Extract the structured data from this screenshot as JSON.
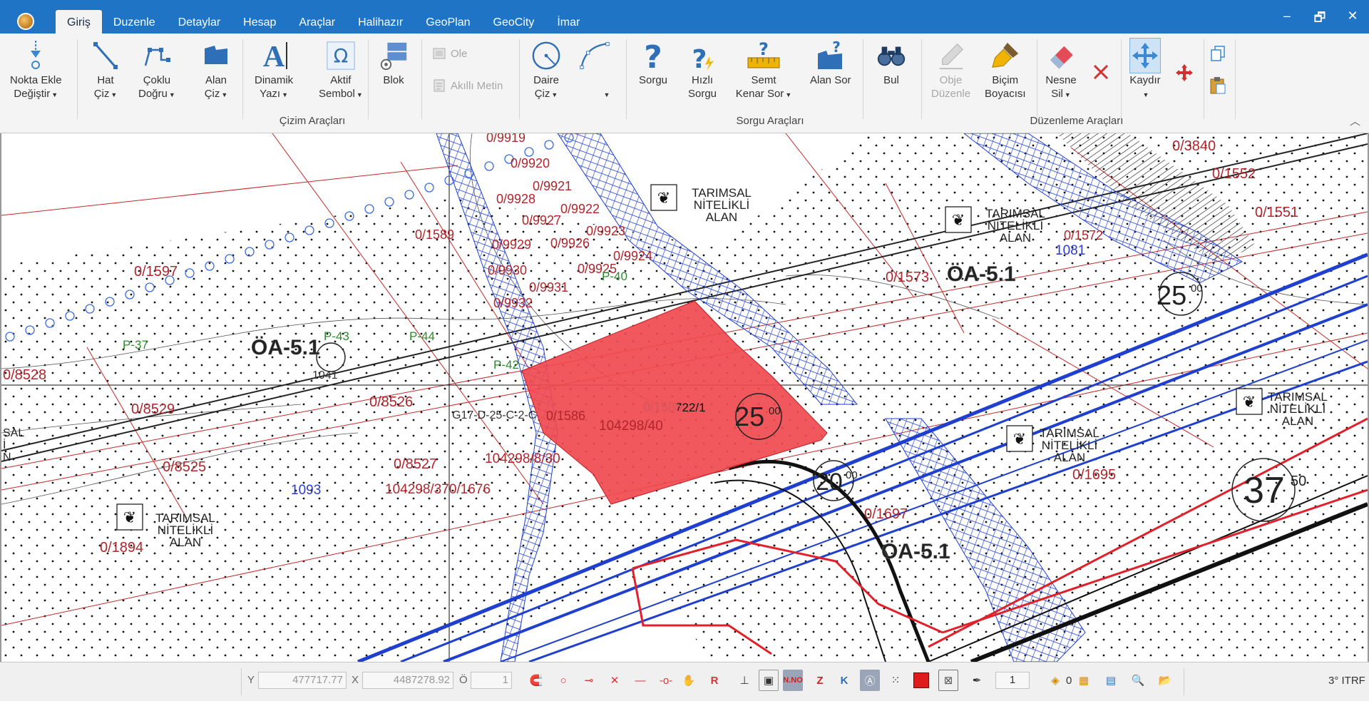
{
  "menu": {
    "tabs": [
      "Giriş",
      "Duzenle",
      "Detaylar",
      "Hesap",
      "Araçlar",
      "Halihazır",
      "GeoPlan",
      "GeoCity",
      "İmar"
    ],
    "active_index": 0
  },
  "window_controls": {
    "minimize": "–",
    "restore": "🗗",
    "close": "✕"
  },
  "ribbon": {
    "buttons": {
      "nokta_ekle": [
        "Nokta Ekle",
        "Değiştir"
      ],
      "hat_ciz": [
        "Hat",
        "Çiz"
      ],
      "coklu_dogru": [
        "Çoklu",
        "Doğru"
      ],
      "alan_ciz": [
        "Alan",
        "Çiz"
      ],
      "dinamik_yazi": [
        "Dinamik",
        "Yazı"
      ],
      "aktif_sembol": [
        "Aktif",
        "Sembol"
      ],
      "blok": "Blok",
      "ole": "Ole",
      "akilli_metin": "Akıllı Metin",
      "daire_ciz": [
        "Daire",
        "Çiz"
      ],
      "sorgu": "Sorgu",
      "hizli_sorgu": [
        "Hızlı",
        "Sorgu"
      ],
      "semt_kenar_sor": [
        "Semt",
        "Kenar Sor"
      ],
      "alan_sor": "Alan Sor",
      "bul": "Bul",
      "obje_duzenle": [
        "Obje",
        "Düzenle"
      ],
      "bicim_boyacisi": [
        "Biçim",
        "Boyacısı"
      ],
      "nesne_sil": [
        "Nesne",
        "Sil"
      ],
      "kaydir": "Kaydır"
    },
    "groups": {
      "cizim": "Çizim Araçları",
      "sorgu": "Sorgu Araçları",
      "duzenleme": "Düzenleme Araçları"
    }
  },
  "map": {
    "selected_parcel": "722/1",
    "highlight_color": "#ef4a4f",
    "labels": {
      "p9919": "0/9919",
      "p9920": "0/9920",
      "p9921": "0/9921",
      "p9928": "0/9928",
      "p9922": "0/9922",
      "p9927": "0/9927",
      "p1589": "0/1589",
      "p9923": "0/9923",
      "p9929": "0/9929",
      "p9926": "0/9926",
      "p9924": "0/9924",
      "p9925": "0/9925",
      "p9930": "0/9930",
      "p9931": "0/9931",
      "p9932": "0/9932",
      "p1597": "0/1597",
      "p8528": "0/8528",
      "p8529": "0/8529",
      "p8526": "0/8526",
      "p8525": "0/8525",
      "p8527": "0/8527",
      "p1586": "0/1586",
      "p1585": "0/1585",
      "p1573": "0/1573",
      "p1572": "0/1572",
      "p1552": "0/1552",
      "p1551": "0/1551",
      "p3840": "0/3840",
      "p1695": "0/1695",
      "p1697": "0/1697",
      "p1894": "0/1894",
      "p10429": "104298/8/30",
      "p10422": "104298/40",
      "p10423": "104298/370/1676",
      "sheet": "G17-D-25-C-2-C",
      "b1093": "1093",
      "b1081": "1081",
      "b1041": "1041",
      "zone1": "ÖA-5.1",
      "zone2": "ÖA-5.1",
      "zone3": "ÖA-5.1",
      "tar1": [
        "TARIMSAL",
        "NİTELİKLİ",
        "ALAN"
      ],
      "tar2": [
        "TARIMSAL",
        "NİTELİKLİ",
        "ALAN"
      ],
      "tar3": [
        "TARIMSAL",
        "NİTELİKLİ",
        "ALAN"
      ],
      "tar4": [
        "TARIMSAL",
        "NİTELİKLİ",
        "ALAN"
      ],
      "tar5": [
        "TARIMSAL",
        "NİTELİKLİ",
        "ALAN"
      ],
      "road1": "25",
      "road1sup": "00",
      "road2": "25",
      "road2sup": "00",
      "road3": "20",
      "road3sup": "00",
      "road4": "37",
      "road4sup": "50",
      "sal": [
        "SAL",
        "İ",
        "N"
      ],
      "p37": "P-37",
      "p43": "P-43",
      "p44": "P-44",
      "p42": "P-42",
      "p40": "P-40"
    }
  },
  "status": {
    "y_label": "Y",
    "y_value": "477717.77",
    "x_label": "X",
    "x_value": "4487278.92",
    "o_label": "Ö",
    "o_value": "1",
    "stepper_value": "1",
    "counter": "0",
    "crs": "3° ITRF"
  }
}
